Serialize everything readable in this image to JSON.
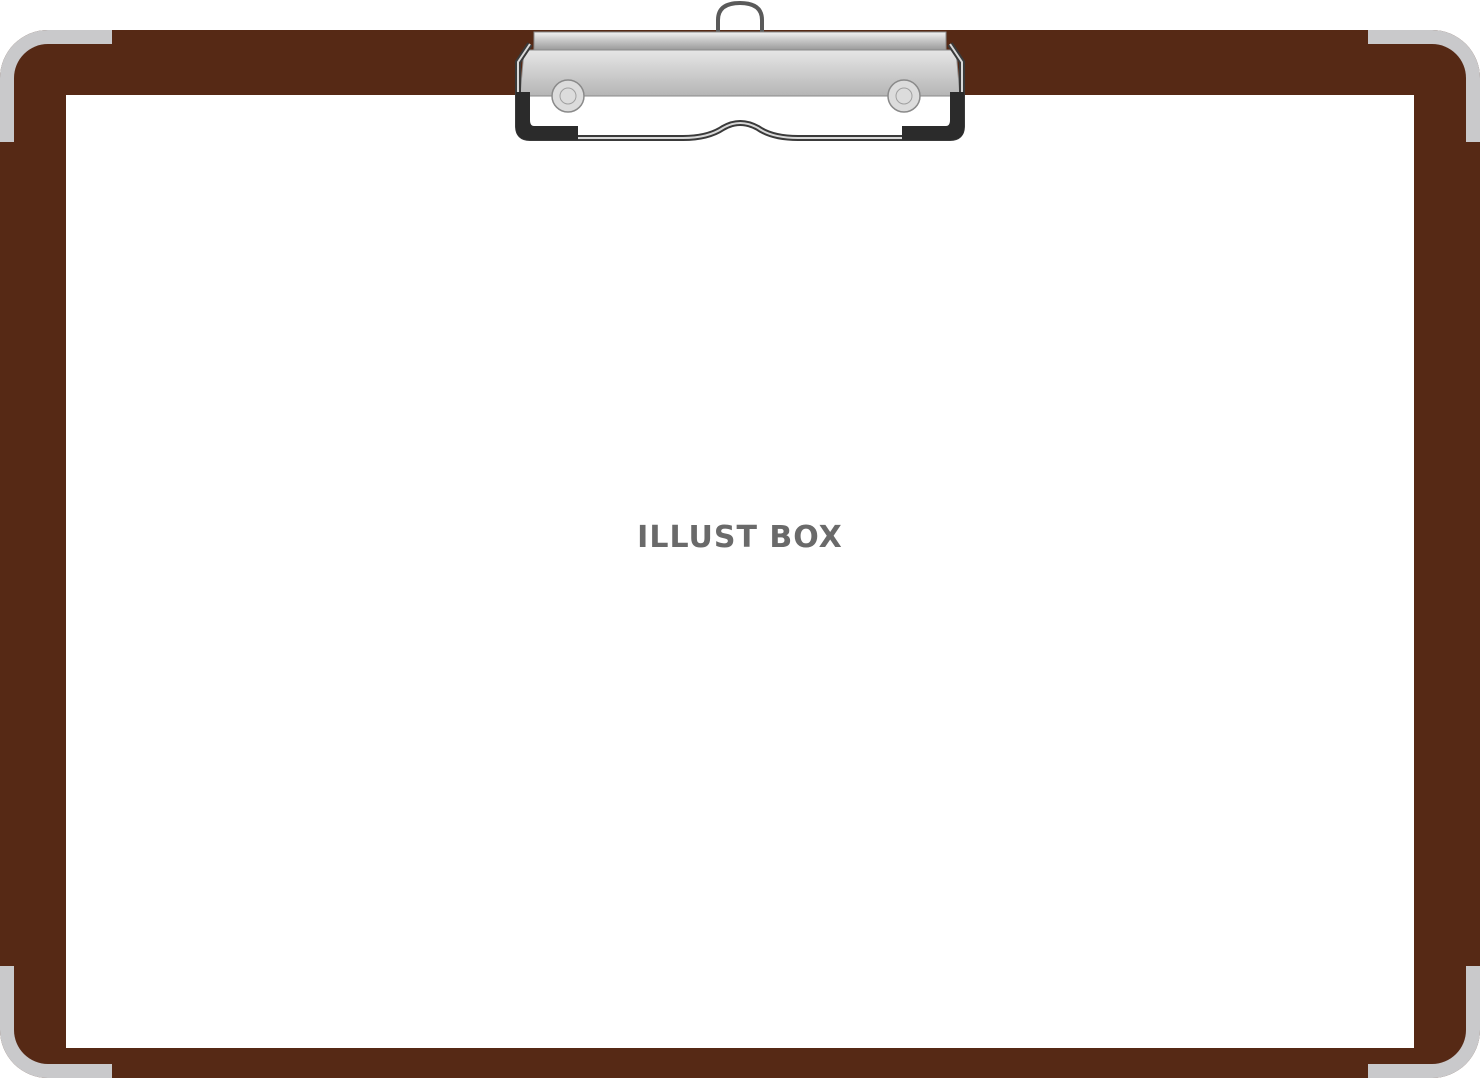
{
  "watermark": {
    "text": "ILLUST BOX"
  },
  "colors": {
    "board": "#562915",
    "corner_guard": "#c9c9cb",
    "paper": "#ffffff",
    "clip_metal": "#bdbdbd",
    "clip_rubber": "#2b2b2b",
    "watermark_text": "#6a6a6a"
  }
}
